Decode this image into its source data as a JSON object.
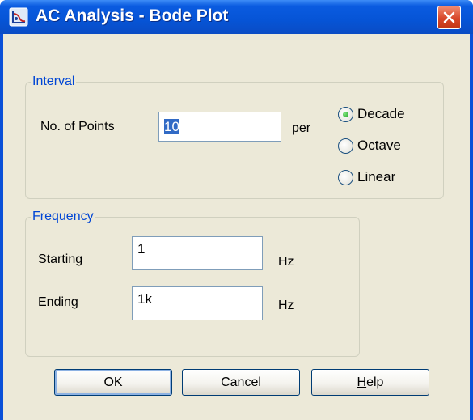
{
  "window": {
    "title": "AC Analysis - Bode Plot",
    "app_icon": "bode-plot-app-icon",
    "close_icon": "close-x-icon"
  },
  "interval": {
    "legend": "Interval",
    "points_label": "No. of Points",
    "points_value": "10",
    "per_label": "per",
    "options": [
      {
        "label": "Decade",
        "selected": true
      },
      {
        "label": "Octave",
        "selected": false
      },
      {
        "label": "Linear",
        "selected": false
      }
    ]
  },
  "frequency": {
    "legend": "Frequency",
    "starting_label": "Starting",
    "starting_value": "1",
    "starting_unit": "Hz",
    "ending_label": "Ending",
    "ending_value": "1k",
    "ending_unit": "Hz"
  },
  "buttons": {
    "ok": "OK",
    "cancel": "Cancel",
    "help_mnemonic": "H",
    "help_rest": "elp"
  },
  "colors": {
    "titlebar": "#0654d6",
    "dialog_bg": "#ece9d8",
    "group_label": "#0046d5",
    "close_button": "#d8472a"
  }
}
